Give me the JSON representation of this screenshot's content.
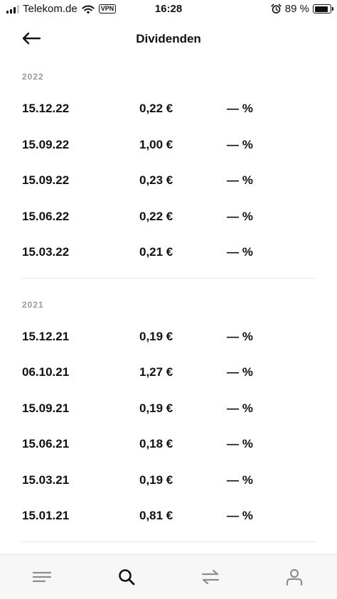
{
  "status_bar": {
    "carrier": "Telekom.de",
    "vpn_label": "VPN",
    "time": "16:28",
    "battery": "89 %",
    "battery_level": 0.89
  },
  "header": {
    "title": "Dividenden",
    "back_icon": "arrow-left-icon"
  },
  "sections": [
    {
      "year": "2022",
      "rows": [
        {
          "date": "15.12.22",
          "amount": "0,22 €",
          "yield": "— %"
        },
        {
          "date": "15.09.22",
          "amount": "1,00 €",
          "yield": "— %"
        },
        {
          "date": "15.09.22",
          "amount": "0,23 €",
          "yield": "— %"
        },
        {
          "date": "15.06.22",
          "amount": "0,22 €",
          "yield": "— %"
        },
        {
          "date": "15.03.22",
          "amount": "0,21 €",
          "yield": "— %"
        }
      ]
    },
    {
      "year": "2021",
      "rows": [
        {
          "date": "15.12.21",
          "amount": "0,19 €",
          "yield": "— %"
        },
        {
          "date": "06.10.21",
          "amount": "1,27 €",
          "yield": "— %"
        },
        {
          "date": "15.09.21",
          "amount": "0,19 €",
          "yield": "— %"
        },
        {
          "date": "15.06.21",
          "amount": "0,18 €",
          "yield": "— %"
        },
        {
          "date": "15.03.21",
          "amount": "0,19 €",
          "yield": "— %"
        },
        {
          "date": "15.01.21",
          "amount": "0,81 €",
          "yield": "— %"
        }
      ]
    }
  ],
  "tab_bar": {
    "tabs": [
      {
        "icon": "menu-lines-icon"
      },
      {
        "icon": "search-icon",
        "active": true
      },
      {
        "icon": "transfer-arrows-icon"
      },
      {
        "icon": "profile-icon"
      }
    ],
    "active_color": "#111111",
    "inactive_color": "#8e8e8e"
  }
}
